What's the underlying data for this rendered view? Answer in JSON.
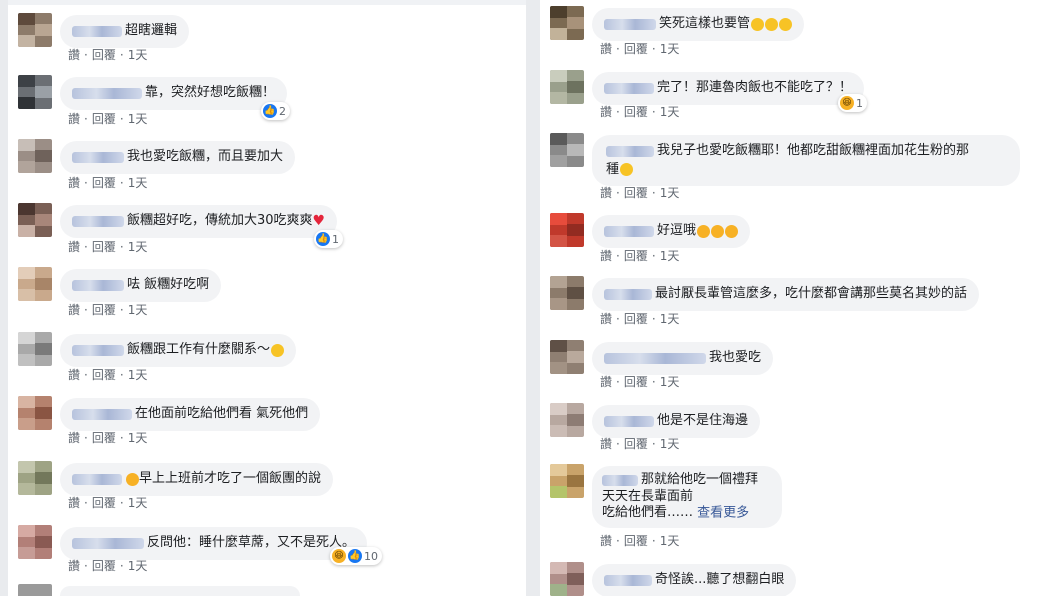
{
  "ui": {
    "like": "讚",
    "reply": "回覆",
    "dot": "·",
    "time": "1天"
  },
  "colors": {
    "link": "#385898",
    "like_blue": "#1877f2",
    "bubble": "#f2f3f5",
    "meta": "#606770"
  },
  "left": [
    {
      "text": "超瞎邏輯"
    },
    {
      "text": "靠，突然好想吃飯糰！",
      "reaction": {
        "icons": [
          "like-icon"
        ],
        "count": "2"
      }
    },
    {
      "text": "我也愛吃飯糰，而且要加大"
    },
    {
      "text": "飯糰超好吃，傳統加大30吃爽爽",
      "reaction": {
        "icons": [
          "like-icon"
        ],
        "count": "1"
      }
    },
    {
      "text": "呿 飯糰好吃啊"
    },
    {
      "text": "飯糰跟工作有什麼關系～"
    },
    {
      "text": "在他面前吃給他們看 氣死他們"
    },
    {
      "text": "早上上班前才吃了一個飯團的說"
    },
    {
      "text": "反問他：睡什麼草蓆，又不是死人。",
      "reaction": {
        "icons": [
          "haha-icon",
          "like-icon"
        ],
        "count": "10"
      }
    }
  ],
  "right": [
    {
      "text": "笑死這樣也要管"
    },
    {
      "text": "完了！那連魯肉飯也不能吃了？！",
      "reaction": {
        "icons": [
          "haha-icon"
        ],
        "count": "1"
      }
    },
    {
      "text": "我兒子也愛吃飯糰耶！他都吃甜飯糰裡面加花生粉的那",
      "text2": "種"
    },
    {
      "text": "好逗哦"
    },
    {
      "text": "最討厭長輩管這麼多，吃什麼都會講那些莫名其妙的話"
    },
    {
      "text": "我也愛吃"
    },
    {
      "text": "他是不是住海邊"
    },
    {
      "text": "那就給他吃一個禮拜",
      "text2": "天天在長輩面前",
      "text3": "吃給他們看……",
      "more": "查看更多"
    },
    {
      "text": "奇怪誒...聽了想翻白眼"
    }
  ]
}
